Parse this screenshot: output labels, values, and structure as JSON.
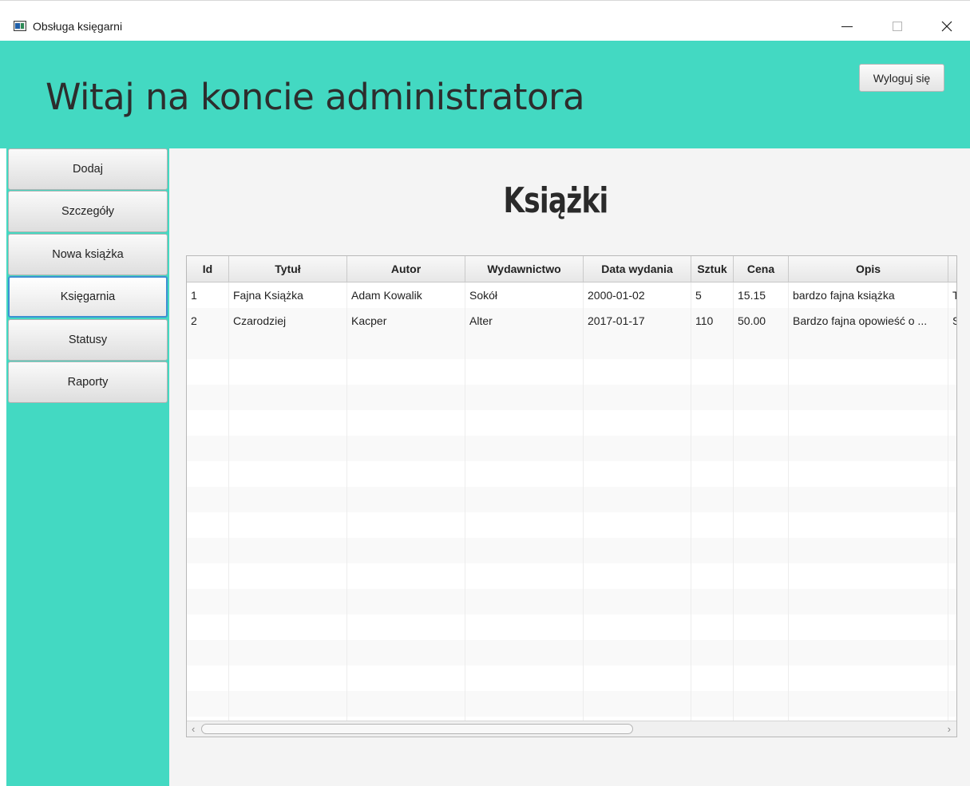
{
  "window": {
    "title": "Obsługa księgarni",
    "icon": "app-window-icon",
    "controls": [
      "minimize-icon",
      "maximize-icon",
      "close-icon"
    ]
  },
  "header": {
    "welcome": "Witaj na koncie administratora",
    "logout_label": "Wyloguj się",
    "background_color": "#43d9c2"
  },
  "sidebar": {
    "items": [
      {
        "label": "Dodaj"
      },
      {
        "label": "Szczegóły"
      },
      {
        "label": "Nowa książka"
      },
      {
        "label": "Księgarnia",
        "active": true
      },
      {
        "label": "Statusy"
      },
      {
        "label": "Raporty"
      }
    ]
  },
  "main": {
    "title": "Książki",
    "table": {
      "columns": [
        "Id",
        "Tytuł",
        "Autor",
        "Wydawnictwo",
        "Data wydania",
        "Sztuk",
        "Cena",
        "Opis"
      ],
      "rows": [
        [
          "1",
          "Fajna Książka",
          "Adam Kowalik",
          "Sokół",
          "2000-01-02",
          "5",
          "15.15",
          "bardzo fajna książka",
          "T"
        ],
        [
          "2",
          "Czarodziej",
          "Kacper",
          "Alter",
          "2017-01-17",
          "110",
          "50.00",
          "Bardzo fajna opowieść o ...",
          "S"
        ]
      ],
      "scroll_left_icon": "chevron-left-icon",
      "scroll_right_icon": "chevron-right-icon"
    }
  },
  "colors": {
    "accent": "#43d9c2",
    "active_border": "#3f8fd2",
    "content_bg": "#f4f4f4"
  }
}
